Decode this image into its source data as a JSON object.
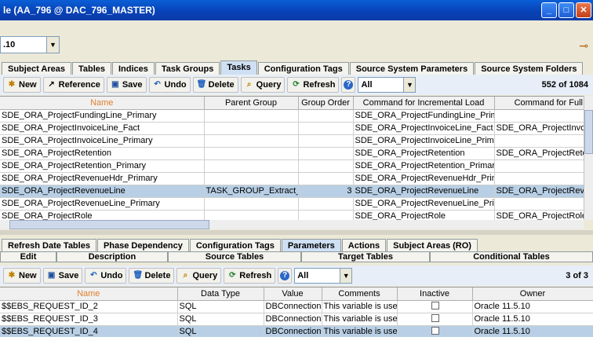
{
  "window": {
    "title": "le (AA_796 @ DAC_796_MASTER)"
  },
  "topbar": {
    "combo_value": ".10"
  },
  "main_tabs": [
    "Subject Areas",
    "Tables",
    "Indices",
    "Task Groups",
    "Tasks",
    "Configuration Tags",
    "Source System Parameters",
    "Source System Folders"
  ],
  "toolbar": {
    "new": "New",
    "reference": "Reference",
    "save": "Save",
    "undo": "Undo",
    "delete": "Delete",
    "query": "Query",
    "refresh": "Refresh",
    "filter": "All",
    "count": "552 of 1084"
  },
  "tasks": {
    "columns": [
      "Name",
      "Parent Group",
      "Group Order",
      "Command for Incremental Load",
      "Command for Full Loa"
    ],
    "rows": [
      [
        "SDE_ORA_ProjectFundingLine_Primary",
        "",
        "",
        "SDE_ORA_ProjectFundingLine_Primary",
        ""
      ],
      [
        "SDE_ORA_ProjectInvoiceLine_Fact",
        "",
        "",
        "SDE_ORA_ProjectInvoiceLine_Fact",
        "SDE_ORA_ProjectInvoice"
      ],
      [
        "SDE_ORA_ProjectInvoiceLine_Primary",
        "",
        "",
        "SDE_ORA_ProjectInvoiceLine_Primary",
        ""
      ],
      [
        "SDE_ORA_ProjectRetention",
        "",
        "",
        "SDE_ORA_ProjectRetention",
        "SDE_ORA_ProjectRetenti"
      ],
      [
        "SDE_ORA_ProjectRetention_Primary",
        "",
        "",
        "SDE_ORA_ProjectRetention_Primary",
        ""
      ],
      [
        "SDE_ORA_ProjectRevenueHdr_Primary",
        "",
        "",
        "SDE_ORA_ProjectRevenueHdr_Primary",
        ""
      ],
      [
        "SDE_ORA_ProjectRevenueLine",
        "TASK_GROUP_Extract_...",
        "3",
        "SDE_ORA_ProjectRevenueLine",
        "SDE_ORA_ProjectRevenu"
      ],
      [
        "SDE_ORA_ProjectRevenueLine_Primary",
        "",
        "",
        "SDE_ORA_ProjectRevenueLine_Prim...",
        ""
      ],
      [
        "SDE_ORA_ProjectRole",
        "",
        "",
        "SDE_ORA_ProjectRole",
        "SDE_ORA_ProjectRole_F"
      ]
    ],
    "selected_row": 6
  },
  "detail_tabs_row1": [
    "Refresh Date Tables",
    "Phase Dependency",
    "Configuration Tags",
    "Parameters",
    "Actions",
    "Subject Areas (RO)"
  ],
  "detail_tabs_row2": [
    "Edit",
    "Description",
    "Source Tables",
    "Target Tables",
    "Conditional Tables"
  ],
  "toolbar2": {
    "new": "New",
    "save": "Save",
    "undo": "Undo",
    "delete": "Delete",
    "query": "Query",
    "refresh": "Refresh",
    "filter": "All",
    "count": "3 of 3"
  },
  "params": {
    "columns": [
      "Name",
      "Data Type",
      "Value",
      "Comments",
      "Inactive",
      "Owner"
    ],
    "rows": [
      [
        "$$EBS_REQUEST_ID_2",
        "SQL",
        "DBConnection...",
        "This variable is use...",
        "",
        "Oracle 11.5.10"
      ],
      [
        "$$EBS_REQUEST_ID_3",
        "SQL",
        "DBConnection...",
        "This variable is use...",
        "",
        "Oracle 11.5.10"
      ],
      [
        "$$EBS_REQUEST_ID_4",
        "SQL",
        "DBConnection...",
        "This variable is use...",
        "",
        "Oracle 11.5.10"
      ]
    ],
    "selected_row": 2
  }
}
